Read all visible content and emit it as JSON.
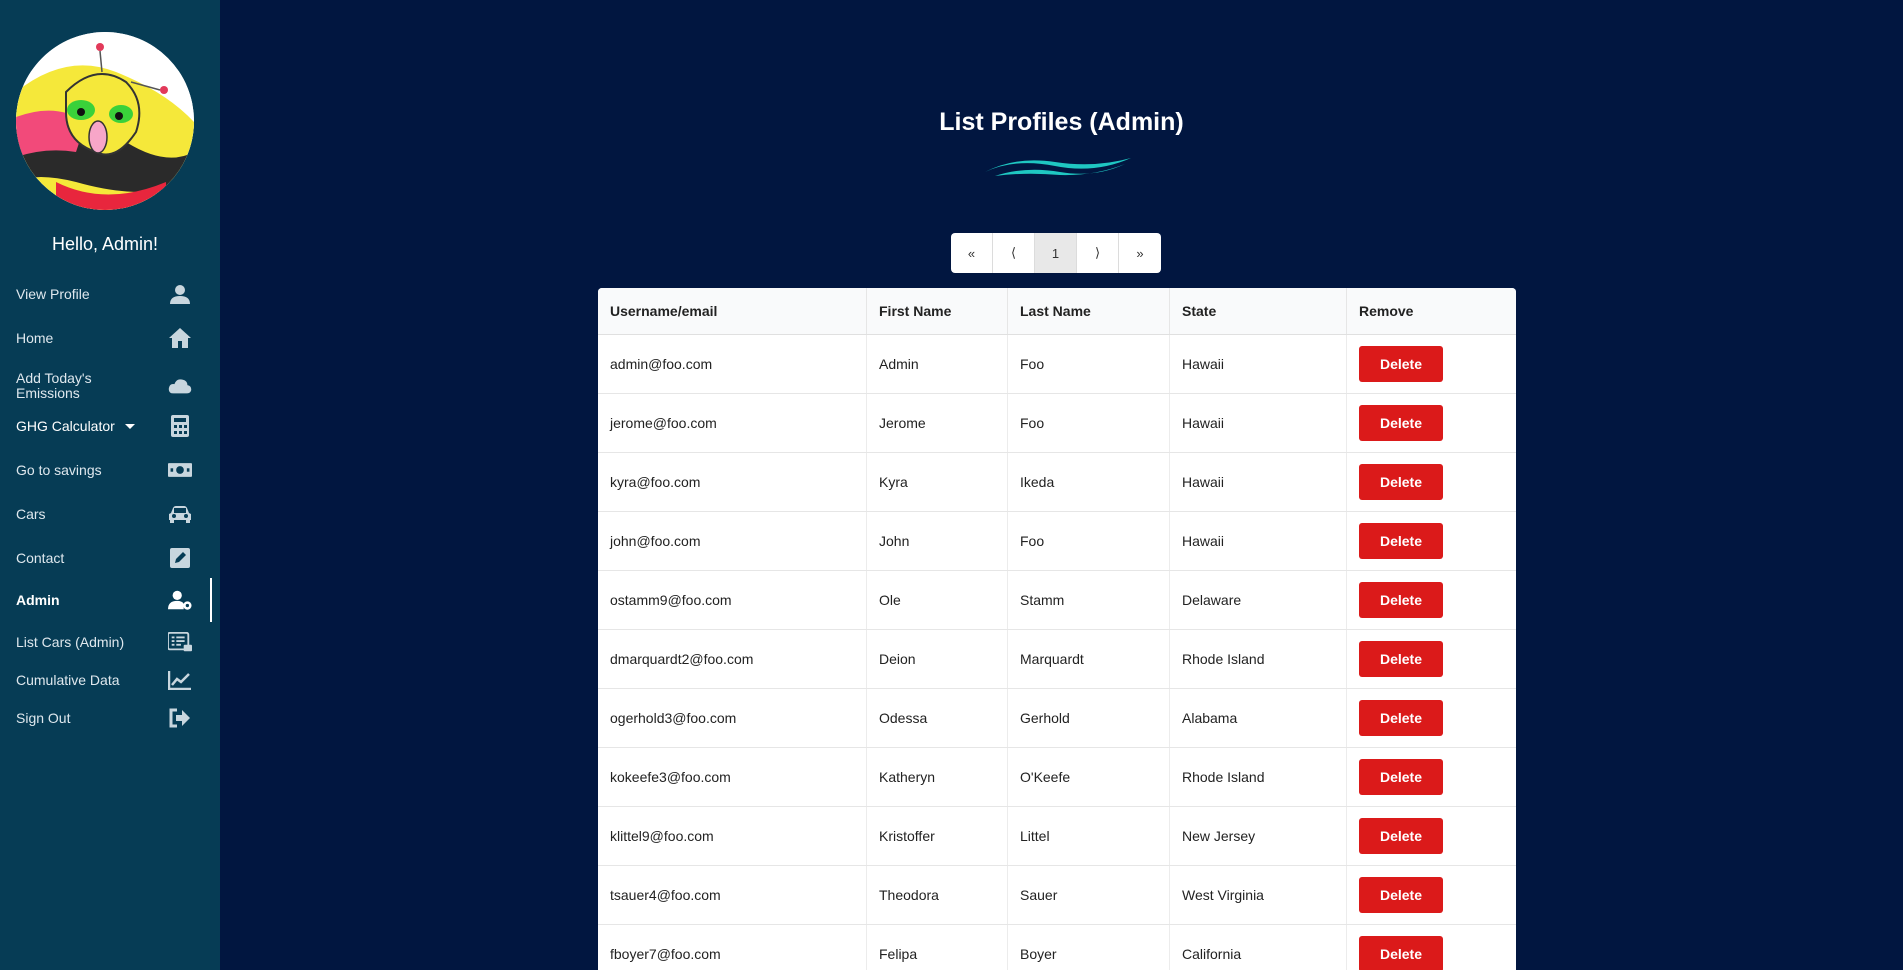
{
  "sidebar": {
    "greeting": "Hello, Admin!",
    "items": [
      {
        "label": "View Profile",
        "icon": "user-icon"
      },
      {
        "label": "Home",
        "icon": "home-icon"
      },
      {
        "label": "Add Today's Emissions",
        "icon": "cloud-icon"
      },
      {
        "label": "GHG Calculator",
        "icon": "calculator-icon"
      },
      {
        "label": "Go to savings",
        "icon": "money-icon"
      },
      {
        "label": "Cars",
        "icon": "car-icon"
      },
      {
        "label": "Contact",
        "icon": "edit-icon"
      },
      {
        "label": "Admin",
        "icon": "user-gear-icon"
      },
      {
        "label": "List Cars (Admin)",
        "icon": "list-icon"
      },
      {
        "label": "Cumulative Data",
        "icon": "chart-line-icon"
      },
      {
        "label": "Sign Out",
        "icon": "sign-out-icon"
      }
    ]
  },
  "main": {
    "title": "List Profiles (Admin)",
    "pager": {
      "first": "«",
      "prev": "⟨",
      "current": "1",
      "next": "⟩",
      "last": "»"
    },
    "table": {
      "headers": [
        "Username/email",
        "First Name",
        "Last Name",
        "State",
        "Remove"
      ],
      "delete_label": "Delete",
      "rows": [
        {
          "email": "admin@foo.com",
          "first": "Admin",
          "last": "Foo",
          "state": "Hawaii"
        },
        {
          "email": "jerome@foo.com",
          "first": "Jerome",
          "last": "Foo",
          "state": "Hawaii"
        },
        {
          "email": "kyra@foo.com",
          "first": "Kyra",
          "last": "Ikeda",
          "state": "Hawaii"
        },
        {
          "email": "john@foo.com",
          "first": "John",
          "last": "Foo",
          "state": "Hawaii"
        },
        {
          "email": "ostamm9@foo.com",
          "first": "Ole",
          "last": "Stamm",
          "state": "Delaware"
        },
        {
          "email": "dmarquardt2@foo.com",
          "first": "Deion",
          "last": "Marquardt",
          "state": "Rhode Island"
        },
        {
          "email": "ogerhold3@foo.com",
          "first": "Odessa",
          "last": "Gerhold",
          "state": "Alabama"
        },
        {
          "email": "kokeefe3@foo.com",
          "first": "Katheryn",
          "last": "O'Keefe",
          "state": "Rhode Island"
        },
        {
          "email": "klittel9@foo.com",
          "first": "Kristoffer",
          "last": "Littel",
          "state": "New Jersey"
        },
        {
          "email": "tsauer4@foo.com",
          "first": "Theodora",
          "last": "Sauer",
          "state": "West Virginia"
        },
        {
          "email": "fboyer7@foo.com",
          "first": "Felipa",
          "last": "Boyer",
          "state": "California"
        }
      ]
    }
  },
  "colors": {
    "background": "#011640",
    "sidebar": "#063c55",
    "delete_button": "#db1a1a",
    "wave": "#1fc7c2"
  }
}
